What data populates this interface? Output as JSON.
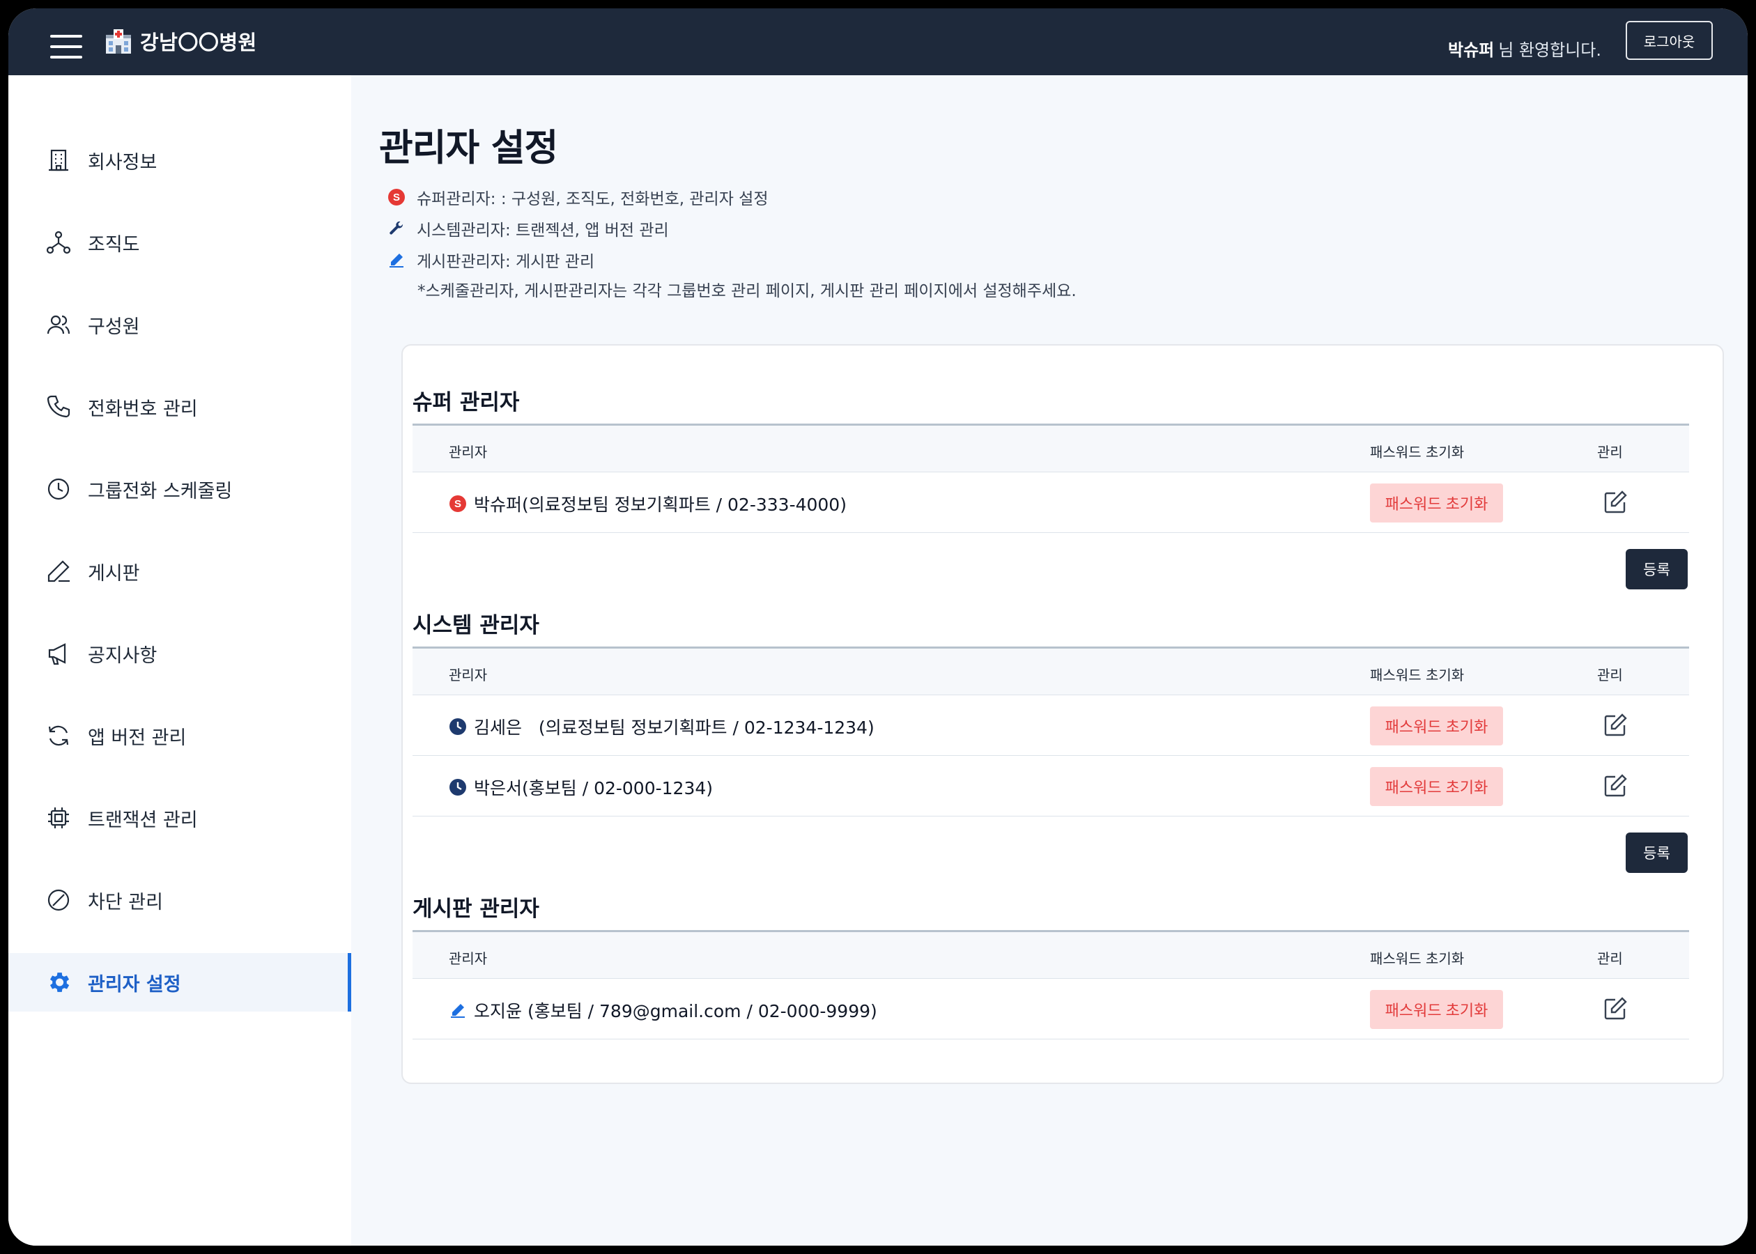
{
  "header": {
    "hospital_name": "강남〇〇병원",
    "user_name": "박슈퍼",
    "welcome_suffix": "님 환영합니다.",
    "logout_label": "로그아웃"
  },
  "sidebar": {
    "items": [
      {
        "label": "회사정보",
        "icon": "building-icon"
      },
      {
        "label": "조직도",
        "icon": "org-chart-icon"
      },
      {
        "label": "구성원",
        "icon": "users-icon"
      },
      {
        "label": "전화번호 관리",
        "icon": "phone-icon"
      },
      {
        "label": "그룹전화 스케줄링",
        "icon": "clock-icon"
      },
      {
        "label": "게시판",
        "icon": "pen-icon"
      },
      {
        "label": "공지사항",
        "icon": "megaphone-icon"
      },
      {
        "label": "앱 버전 관리",
        "icon": "refresh-icon"
      },
      {
        "label": "트랜잭션 관리",
        "icon": "chip-icon"
      },
      {
        "label": "차단 관리",
        "icon": "block-icon"
      },
      {
        "label": "관리자 설정",
        "icon": "gear-icon",
        "active": true
      }
    ]
  },
  "page": {
    "title": "관리자 설정",
    "legend": [
      {
        "icon": "super-badge-icon",
        "text": "슈퍼관리자: : 구성원, 조직도, 전화번호, 관리자 설정"
      },
      {
        "icon": "wrench-icon",
        "text": "시스템관리자: 트랜젝션, 앱 버전 관리"
      },
      {
        "icon": "pen-blue-icon",
        "text": "게시판관리자: 게시판 관리"
      }
    ],
    "note": "*스케줄관리자, 게시판관리자는 각각 그룹번호 관리 페이지, 게시판 관리 페이지에서 설정해주세요."
  },
  "table_headers": {
    "admin": "관리자",
    "reset": "패스워드 초기화",
    "manage": "관리"
  },
  "sections": {
    "super": {
      "title": "슈퍼 관리자",
      "rows": [
        {
          "icon": "super-badge-icon",
          "name": "박슈퍼(의료정보팀 정보기획파트 / 02-333-4000)",
          "reset_label": "패스워드 초기화"
        }
      ],
      "register_label": "등록"
    },
    "system": {
      "title": "시스템 관리자",
      "rows": [
        {
          "icon": "clock-filled-icon",
          "name": "김세은   (의료정보팀 정보기획파트 / 02-1234-1234)",
          "reset_label": "패스워드 초기화"
        },
        {
          "icon": "clock-filled-icon",
          "name": "박은서(홍보팀 / 02-000-1234)",
          "reset_label": "패스워드 초기화"
        }
      ],
      "register_label": "등록"
    },
    "board": {
      "title": "게시판 관리자",
      "rows": [
        {
          "icon": "pen-blue-icon",
          "name": "오지윤 (홍보팀 / 789@gmail.com / 02-000-9999)",
          "reset_label": "패스워드 초기화"
        }
      ]
    }
  },
  "colors": {
    "topbar": "#1e293b",
    "accent": "#1d6fe0",
    "reset_bg": "#fdd5d5",
    "reset_text": "#e23b3b",
    "super_badge": "#e53935",
    "system_icon": "#1e3a6e"
  }
}
